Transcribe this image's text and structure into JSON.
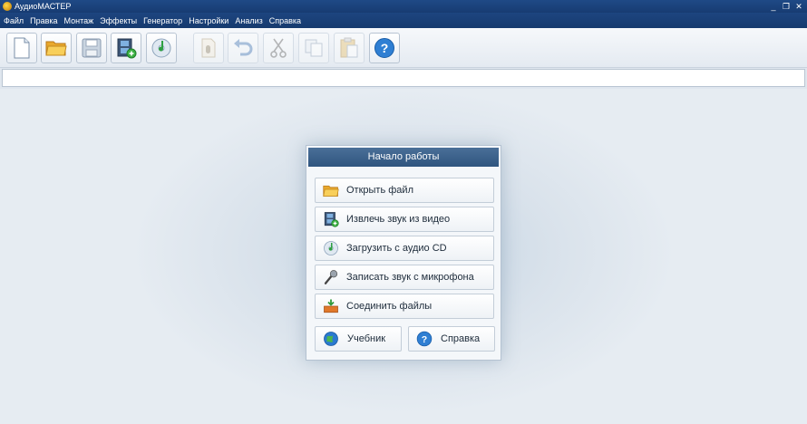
{
  "window": {
    "title": "АудиоМАСТЕР",
    "controls": [
      "_",
      "❐",
      "✕"
    ]
  },
  "menu": [
    "Файл",
    "Правка",
    "Монтаж",
    "Эффекты",
    "Генератор",
    "Настройки",
    "Анализ",
    "Справка"
  ],
  "toolbar": {
    "buttons": [
      {
        "icon": "new-file-icon",
        "enabled": true
      },
      {
        "icon": "open-folder-icon",
        "enabled": true
      },
      {
        "icon": "save-icon",
        "enabled": true
      },
      {
        "icon": "video-extract-icon",
        "enabled": true
      },
      {
        "icon": "audio-cd-icon",
        "enabled": true
      },
      {
        "icon": "record-icon",
        "enabled": false
      },
      {
        "icon": "undo-icon",
        "enabled": false
      },
      {
        "icon": "cut-icon",
        "enabled": false
      },
      {
        "icon": "copy-icon",
        "enabled": false
      },
      {
        "icon": "paste-icon",
        "enabled": false
      },
      {
        "icon": "help-icon",
        "enabled": true
      }
    ]
  },
  "path_field": {
    "value": ""
  },
  "start_panel": {
    "title": "Начало работы",
    "actions": [
      {
        "label": "Открыть файл",
        "icon": "open-folder-icon"
      },
      {
        "label": "Извлечь звук из видео",
        "icon": "video-extract-icon"
      },
      {
        "label": "Загрузить с аудио CD",
        "icon": "audio-cd-icon"
      },
      {
        "label": "Записать звук с микрофона",
        "icon": "microphone-icon"
      },
      {
        "label": "Соединить файлы",
        "icon": "join-files-icon"
      }
    ],
    "tutorial_label": "Учебник",
    "help_label": "Справка"
  },
  "colors": {
    "titlebar": "#1f4a86",
    "panel_header": "#3a608a",
    "background": "#dfe6ee"
  }
}
